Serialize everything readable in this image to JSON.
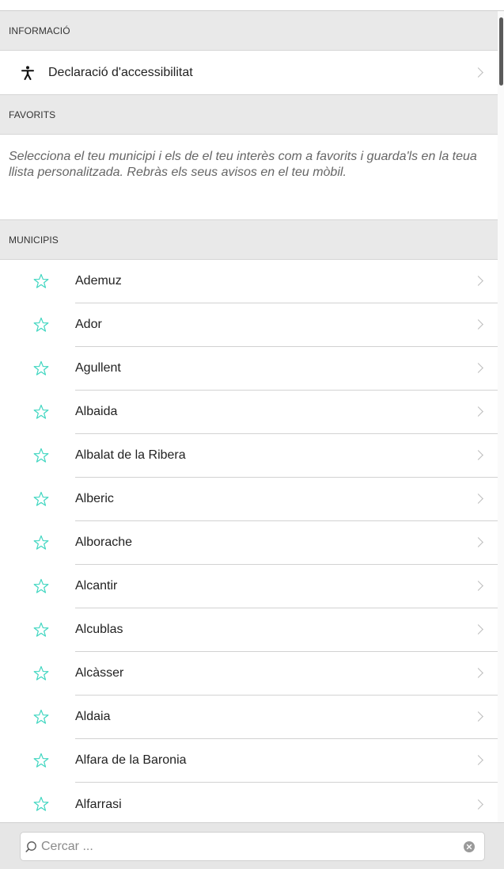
{
  "sections": {
    "info_header": "INFORMACIÓ",
    "accessibility_label": "Declaració d'accessibilitat",
    "favorites_header": "FAVORITS",
    "favorites_text": "Selecciona el teu municipi i els de el teu interès com a favorits i guarda'ls en la teua llista personalitzada. Rebràs els seus avisos en el teu mòbil.",
    "municipalities_header": "MUNICIPIS"
  },
  "municipalities": [
    {
      "name": "Ademuz"
    },
    {
      "name": "Ador"
    },
    {
      "name": "Agullent"
    },
    {
      "name": "Albaida"
    },
    {
      "name": "Albalat de la Ribera"
    },
    {
      "name": "Alberic"
    },
    {
      "name": "Alborache"
    },
    {
      "name": "Alcantir"
    },
    {
      "name": "Alcublas"
    },
    {
      "name": "Alcàsser"
    },
    {
      "name": "Aldaia"
    },
    {
      "name": "Alfara de la Baronia"
    },
    {
      "name": "Alfarrasi"
    }
  ],
  "search": {
    "placeholder": "Cercar ...",
    "value": ""
  },
  "icons": {
    "star": "star-outline-icon",
    "accessibility": "accessibility-person-icon",
    "chevron": "chevron-right-icon",
    "search": "search-icon",
    "clear": "clear-icon"
  },
  "colors": {
    "star": "#3fd6c0",
    "header_bg": "#e9e9e9",
    "footer_bg": "#e6e6e6"
  }
}
